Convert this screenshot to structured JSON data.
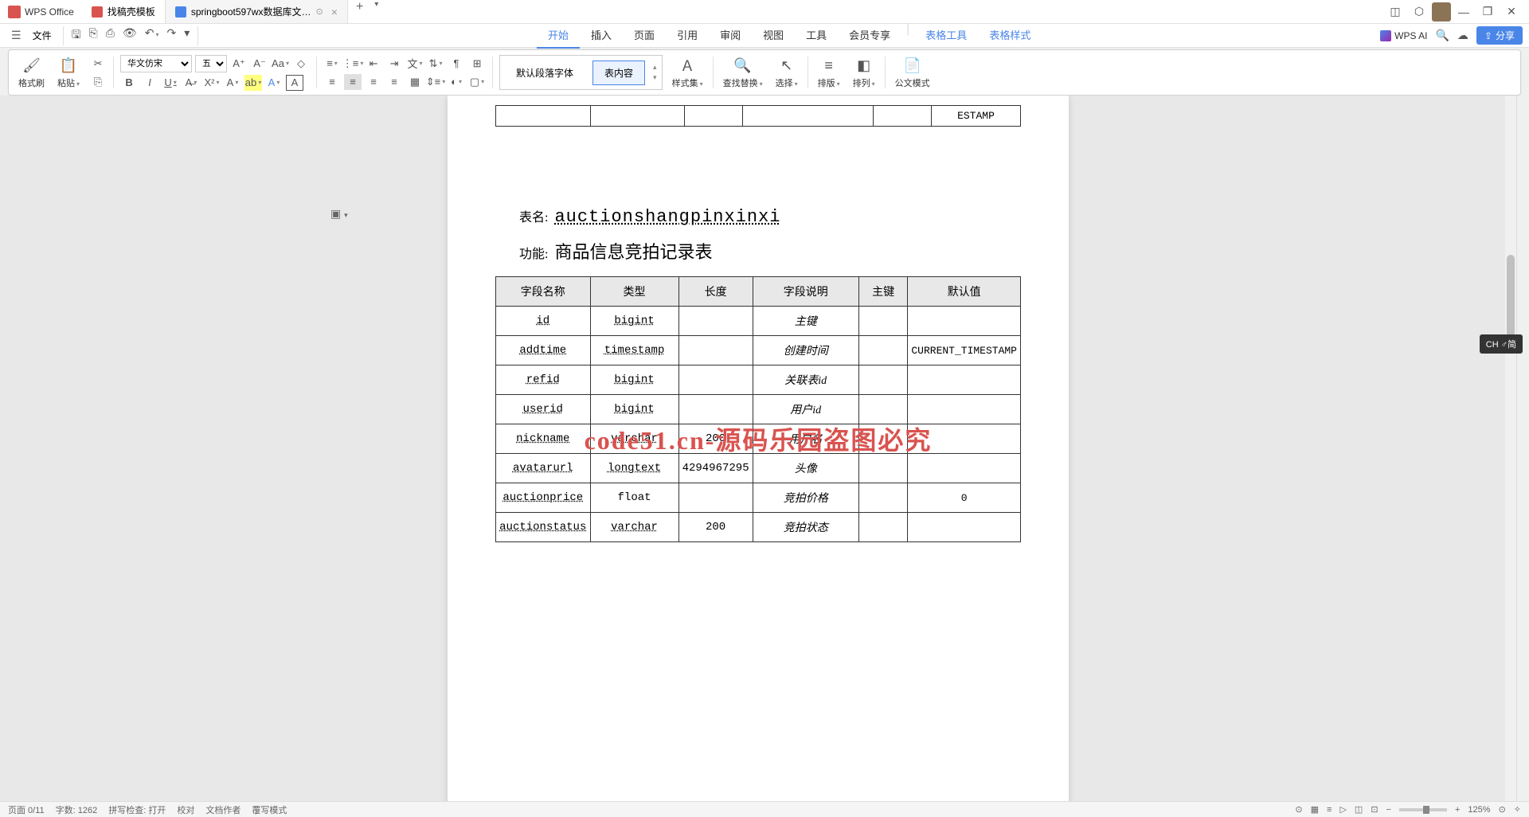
{
  "app": {
    "name": "WPS Office"
  },
  "tabs": [
    {
      "label": "找稿壳模板",
      "icon": "red",
      "active": false
    },
    {
      "label": "springboot597wx数据库文…",
      "icon": "blue",
      "active": true
    }
  ],
  "file_menu": "文件",
  "menu_tabs": {
    "start": "开始",
    "insert": "插入",
    "page": "页面",
    "ref": "引用",
    "review": "审阅",
    "view": "视图",
    "tools": "工具",
    "member": "会员专享",
    "table_tools": "表格工具",
    "table_style": "表格样式"
  },
  "wps_ai": "WPS AI",
  "share_btn": "分享",
  "ribbon": {
    "format_painter": "格式刷",
    "paste": "粘贴",
    "font_name": "华文仿宋",
    "font_size": "五号",
    "default_para": "默认段落字体",
    "table_content": "表内容",
    "style_set": "样式集",
    "find_replace": "查找替换",
    "select": "选择",
    "sort": "排版",
    "arrange": "排列",
    "gov_mode": "公文模式"
  },
  "doc": {
    "prev_cell": "ESTAMP",
    "table_label": "表名:",
    "table_name": "auctionshangpinxinxi",
    "func_label": "功能:",
    "func_name": "商品信息竞拍记录表",
    "headers": {
      "field": "字段名称",
      "type": "类型",
      "length": "长度",
      "desc": "字段说明",
      "pk": "主键",
      "default": "默认值"
    },
    "rows": [
      {
        "field": "id",
        "type": "bigint",
        "length": "",
        "desc": "主键",
        "pk": "",
        "default": ""
      },
      {
        "field": "addtime",
        "type": "timestamp",
        "length": "",
        "desc": "创建时间",
        "pk": "",
        "default": "CURRENT_TIMESTAMP"
      },
      {
        "field": "refid",
        "type": "bigint",
        "length": "",
        "desc": "关联表id",
        "pk": "",
        "default": ""
      },
      {
        "field": "userid",
        "type": "bigint",
        "length": "",
        "desc": "用户id",
        "pk": "",
        "default": ""
      },
      {
        "field": "nickname",
        "type": "varchar",
        "length": "200",
        "desc": "用户名",
        "pk": "",
        "default": ""
      },
      {
        "field": "avatarurl",
        "type": "longtext",
        "length": "4294967295",
        "desc": "头像",
        "pk": "",
        "default": ""
      },
      {
        "field": "auctionprice",
        "type": "float",
        "length": "",
        "desc": "竞拍价格",
        "pk": "",
        "default": "0"
      },
      {
        "field": "auctionstatus",
        "type": "varchar",
        "length": "200",
        "desc": "竞拍状态",
        "pk": "",
        "default": ""
      }
    ],
    "watermark": "code51.cn-源码乐园盗图必究"
  },
  "status": {
    "page": "页面 0/11",
    "words": "字数: 1262",
    "spell": "拼写检查: 打开",
    "proof": "校对",
    "author": "文档作者",
    "mode": "覆写模式",
    "zoom": "125%"
  },
  "ime": "CH ♂简"
}
